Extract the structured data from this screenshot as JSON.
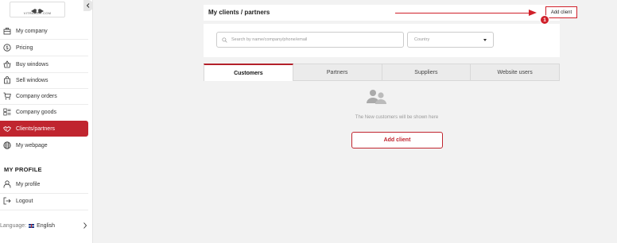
{
  "brand": {
    "logo_text": "VITRAGER.COM"
  },
  "sidebar": {
    "items": [
      {
        "label": "My company",
        "icon": "briefcase-icon"
      },
      {
        "label": "Pricing",
        "icon": "dollar-circle-icon"
      },
      {
        "label": "Buy windows",
        "icon": "basket-icon"
      },
      {
        "label": "Sell windows",
        "icon": "bag-icon"
      },
      {
        "label": "Company orders",
        "icon": "cart-icon"
      },
      {
        "label": "Company goods",
        "icon": "goods-list-icon"
      },
      {
        "label": "Clients/partners",
        "icon": "handshake-icon",
        "active": true
      },
      {
        "label": "My webpage",
        "icon": "globe-icon"
      }
    ],
    "profile_title": "MY PROFILE",
    "profile_items": [
      {
        "label": "My profile",
        "icon": "user-icon"
      },
      {
        "label": "Logout",
        "icon": "logout-icon"
      }
    ],
    "language": {
      "label": "Language:",
      "value": "English"
    }
  },
  "header": {
    "title": "My clients / partners",
    "add_button": "Add client",
    "step_badge": "1"
  },
  "filters": {
    "search_placeholder": "Search by name/company/phone/email",
    "country_placeholder": "Country"
  },
  "tabs": [
    {
      "label": "Customers",
      "active": true
    },
    {
      "label": "Partners"
    },
    {
      "label": "Suppliers"
    },
    {
      "label": "Website users"
    }
  ],
  "empty_state": {
    "message": "The New customers will be shown here",
    "button": "Add client"
  },
  "colors": {
    "accent": "#c0252f",
    "arrow": "#d0202a",
    "background": "#f2f2f2"
  }
}
